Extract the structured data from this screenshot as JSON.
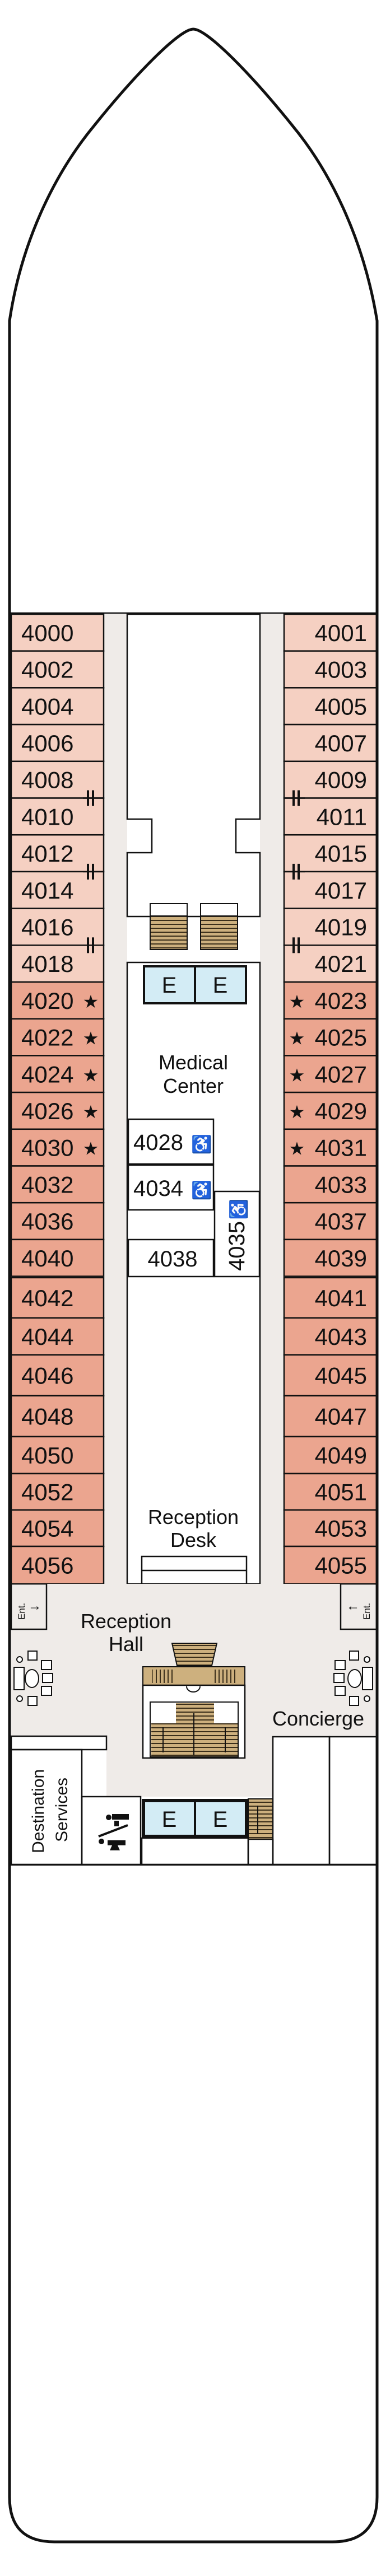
{
  "colors": {
    "cabin_light": "#f5d0c2",
    "cabin_dark": "#eba58f",
    "accessible_cabin": "#fbf0c3",
    "corridor": "#efebe8",
    "elevator": "#d3ecf5",
    "stairs": "#cdb07e",
    "restroom": "#f9dcc3",
    "outline": "#111111"
  },
  "port_cabins": [
    {
      "number": "4000",
      "tier": "light"
    },
    {
      "number": "4002",
      "tier": "light"
    },
    {
      "number": "4004",
      "tier": "light"
    },
    {
      "number": "4006",
      "tier": "light"
    },
    {
      "number": "4008",
      "tier": "light"
    },
    {
      "number": "4010",
      "tier": "light"
    },
    {
      "number": "4012",
      "tier": "light"
    },
    {
      "number": "4014",
      "tier": "light"
    },
    {
      "number": "4016",
      "tier": "light"
    },
    {
      "number": "4018",
      "tier": "light"
    },
    {
      "number": "4020",
      "tier": "dark",
      "star": true
    },
    {
      "number": "4022",
      "tier": "dark",
      "star": true
    },
    {
      "number": "4024",
      "tier": "dark",
      "star": true
    },
    {
      "number": "4026",
      "tier": "dark",
      "star": true
    },
    {
      "number": "4030",
      "tier": "dark",
      "star": true
    },
    {
      "number": "4032",
      "tier": "dark"
    },
    {
      "number": "4036",
      "tier": "dark"
    },
    {
      "number": "4040",
      "tier": "dark"
    },
    {
      "number": "4042",
      "tier": "dark"
    },
    {
      "number": "4044",
      "tier": "dark"
    },
    {
      "number": "4046",
      "tier": "dark"
    },
    {
      "number": "4048",
      "tier": "dark"
    },
    {
      "number": "4050",
      "tier": "dark"
    },
    {
      "number": "4052",
      "tier": "dark"
    },
    {
      "number": "4054",
      "tier": "dark"
    },
    {
      "number": "4056",
      "tier": "dark"
    }
  ],
  "starboard_cabins": [
    {
      "number": "4001",
      "tier": "light"
    },
    {
      "number": "4003",
      "tier": "light"
    },
    {
      "number": "4005",
      "tier": "light"
    },
    {
      "number": "4007",
      "tier": "light"
    },
    {
      "number": "4009",
      "tier": "light"
    },
    {
      "number": "4011",
      "tier": "light"
    },
    {
      "number": "4015",
      "tier": "light"
    },
    {
      "number": "4017",
      "tier": "light"
    },
    {
      "number": "4019",
      "tier": "light"
    },
    {
      "number": "4021",
      "tier": "light"
    },
    {
      "number": "4023",
      "tier": "dark",
      "star": true
    },
    {
      "number": "4025",
      "tier": "dark",
      "star": true
    },
    {
      "number": "4027",
      "tier": "dark",
      "star": true
    },
    {
      "number": "4029",
      "tier": "dark",
      "star": true
    },
    {
      "number": "4031",
      "tier": "dark",
      "star": true
    },
    {
      "number": "4033",
      "tier": "dark"
    },
    {
      "number": "4037",
      "tier": "dark"
    },
    {
      "number": "4039",
      "tier": "dark"
    },
    {
      "number": "4041",
      "tier": "dark"
    },
    {
      "number": "4043",
      "tier": "dark"
    },
    {
      "number": "4045",
      "tier": "dark"
    },
    {
      "number": "4047",
      "tier": "dark"
    },
    {
      "number": "4049",
      "tier": "dark"
    },
    {
      "number": "4051",
      "tier": "dark"
    },
    {
      "number": "4053",
      "tier": "dark"
    },
    {
      "number": "4055",
      "tier": "dark"
    }
  ],
  "connecting_door_between": [
    [
      4,
      5
    ],
    [
      6,
      7
    ],
    [
      8,
      9
    ]
  ],
  "inner_cabins": {
    "c4028": {
      "number": "4028",
      "accessible": true
    },
    "c4034": {
      "number": "4034",
      "accessible": true
    },
    "c4038": {
      "number": "4038",
      "accessible": false
    },
    "c4035": {
      "number": "4035",
      "accessible": true
    }
  },
  "symbols": {
    "star": "★",
    "wheelchair": "♿",
    "elevator": "E",
    "restroom": "restroom-icon"
  },
  "labels": {
    "medical_line1": "Medical",
    "medical_line2": "Center",
    "reception_desk_line1": "Reception",
    "reception_desk_line2": "Desk",
    "reception_hall_line1": "Reception",
    "reception_hall_line2": "Hall",
    "concierge": "Concierge",
    "destination_line1": "Destination",
    "destination_line2": "Services",
    "entrance": "Ent."
  }
}
